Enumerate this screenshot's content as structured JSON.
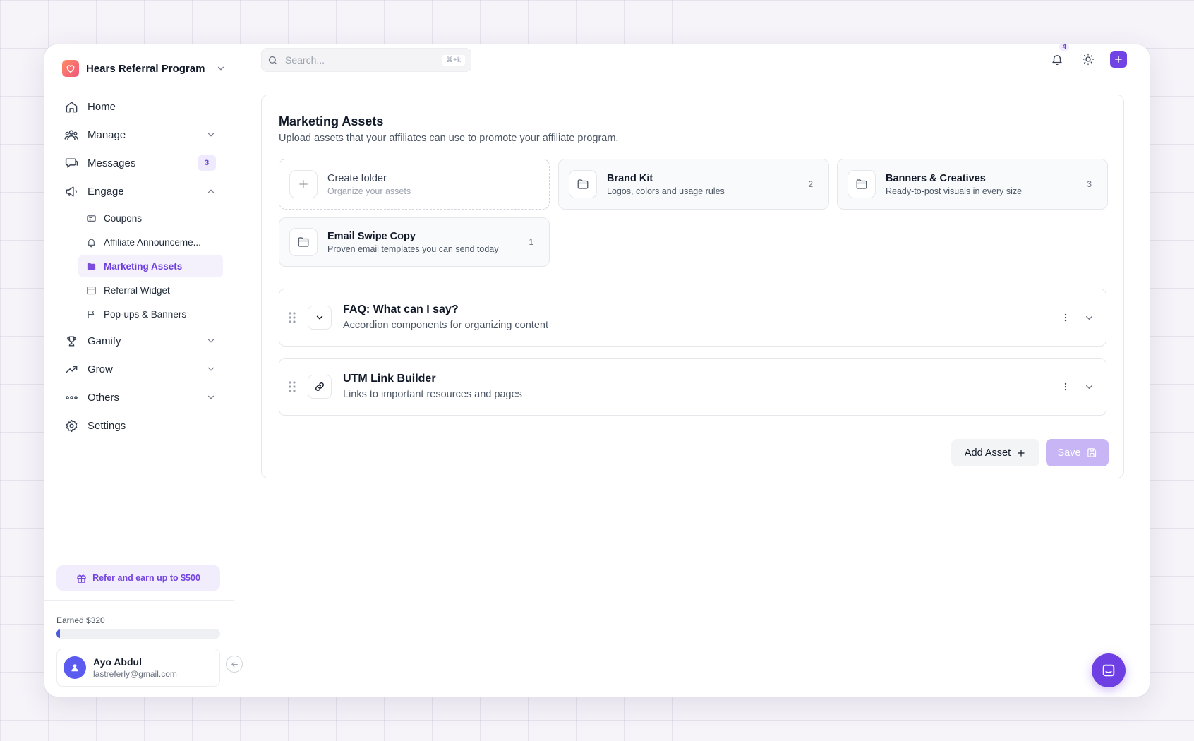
{
  "brand": {
    "name": "Hears Referral Program"
  },
  "sidebar": {
    "items": [
      {
        "label": "Home",
        "icon": "home-icon"
      },
      {
        "label": "Manage",
        "icon": "users-icon"
      },
      {
        "label": "Messages",
        "icon": "chat-icon",
        "badge": "3"
      },
      {
        "label": "Engage",
        "icon": "megaphone-icon"
      },
      {
        "label": "Gamify",
        "icon": "trophy-icon"
      },
      {
        "label": "Grow",
        "icon": "trending-up-icon"
      },
      {
        "label": "Others",
        "icon": "dots-icon"
      },
      {
        "label": "Settings",
        "icon": "gear-icon"
      }
    ],
    "engage_sub": [
      {
        "label": "Coupons",
        "icon": "ticket-icon"
      },
      {
        "label": "Affiliate Announceme...",
        "icon": "bell-icon"
      },
      {
        "label": "Marketing Assets",
        "icon": "folder-icon",
        "active": true
      },
      {
        "label": "Referral Widget",
        "icon": "window-icon"
      },
      {
        "label": "Pop-ups & Banners",
        "icon": "flag-icon"
      }
    ],
    "refer": "Refer and earn up to $500",
    "earned": "Earned $320",
    "progress": 0.01,
    "user": {
      "name": "Ayo Abdul",
      "email": "lastreferly@gmail.com"
    }
  },
  "topbar": {
    "search_placeholder": "Search...",
    "shortcut": "⌘+k",
    "notifications": "4"
  },
  "main": {
    "title": "Marketing Assets",
    "subtitle": "Upload assets that your affiliates can use to promote your affiliate program.",
    "create_folder": {
      "name": "Create folder",
      "desc": "Organize your assets"
    },
    "folders": [
      {
        "name": "Brand Kit",
        "desc": "Logos, colors and usage rules",
        "count": "2"
      },
      {
        "name": "Banners & Creatives",
        "desc": "Ready-to-post visuals in every size",
        "count": "3"
      },
      {
        "name": "Email Swipe Copy",
        "desc": "Proven email templates you can send today",
        "count": "1"
      }
    ],
    "accordions": [
      {
        "title": "FAQ: What can I say?",
        "desc": "Accordion components for organizing content"
      },
      {
        "title": "UTM Link Builder",
        "desc": "Links to important resources and pages"
      }
    ],
    "add_asset": "Add Asset",
    "save": "Save"
  },
  "colors": {
    "accent": "#7243e4",
    "accent_soft": "#f1edfd",
    "save_disabled": "#c7b5f5"
  }
}
